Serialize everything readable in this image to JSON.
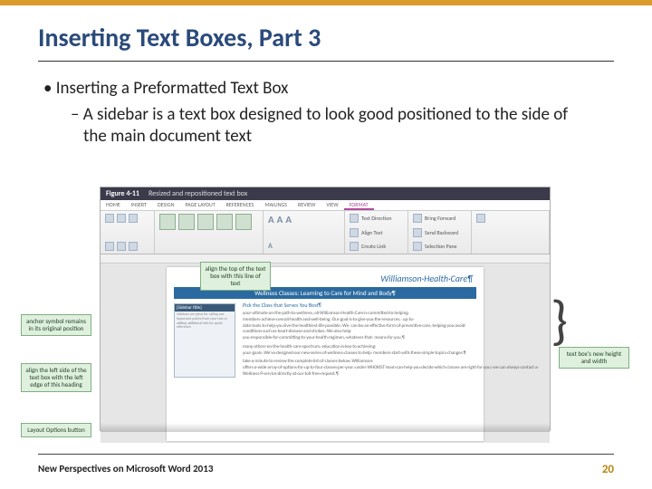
{
  "title": "Inserting Text Boxes, Part 3",
  "bullets": {
    "l1": "Inserting a Preformatted Text Box",
    "l2": "A sidebar is a text box designed to look good positioned to the side of the main document text"
  },
  "figure": {
    "number": "Figure 4-11",
    "caption": "Resized and repositioned text box",
    "tabs": {
      "home": "HOME",
      "insert": "INSERT",
      "design": "DESIGN",
      "layout": "PAGE LAYOUT",
      "refs": "REFERENCES",
      "mail": "MAILINGS",
      "review": "REVIEW",
      "view": "VIEW",
      "format": "FORMAT"
    },
    "doc_title": "Williamson·Health·Care¶",
    "doc_subtitle": "Wellness Classes: Learning to Care for Mind and Body¶",
    "body_heading": "Pick the Class that Serves You Best¶",
    "sidebar_head": "[Sidebar title]",
    "callouts": {
      "anchor": "anchor symbol remains in its original position",
      "aligntop": "align the top of the text box with this line of text",
      "alignleft": "align the left side of the text box with the left edge of this heading",
      "layout": "Layout Options button",
      "newsize": "text box's new height and width"
    }
  },
  "footer": {
    "left": "New Perspectives on Microsoft Word 2013",
    "page": "20"
  }
}
